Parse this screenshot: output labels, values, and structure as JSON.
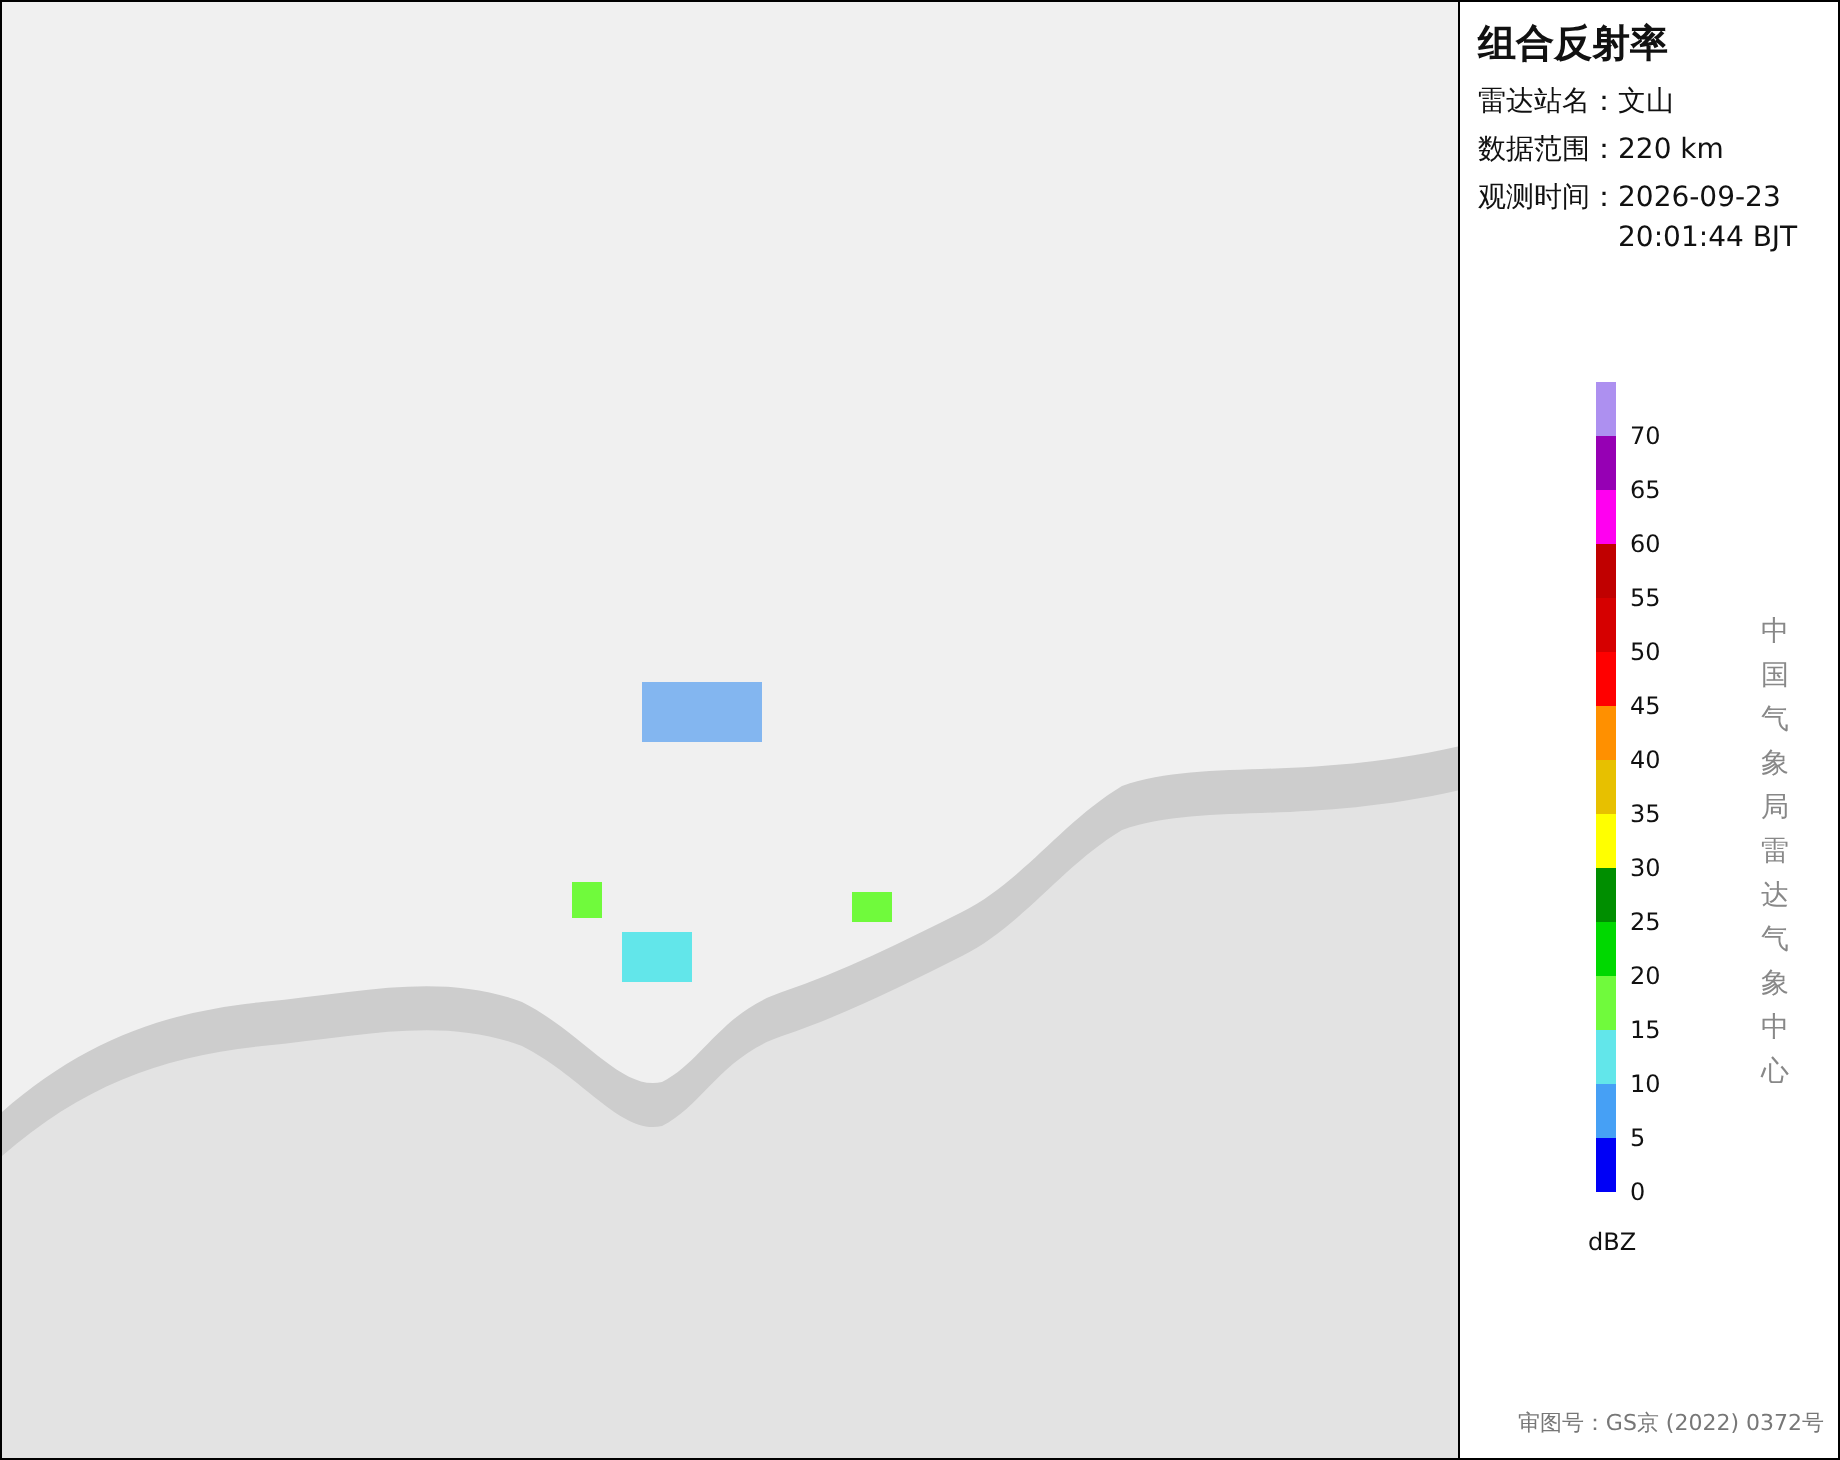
{
  "panel": {
    "title": "组合反射率",
    "info": [
      {
        "label": "雷达站名：",
        "value": "文山"
      },
      {
        "label": "数据范围：",
        "value": "220 km"
      },
      {
        "label": "观测时间：",
        "value": "2026-09-23 20:01:44 BJT"
      }
    ]
  },
  "legend": {
    "scale": [
      {
        "color": "#ad90f0"
      },
      {
        "color": "#9600b4",
        "label": "70"
      },
      {
        "color": "#ff00f0",
        "label": "65"
      },
      {
        "color": "#c00000",
        "label": "60"
      },
      {
        "color": "#d60000",
        "label": "55"
      },
      {
        "color": "#ff0000",
        "label": "50"
      },
      {
        "color": "#ff9000",
        "label": "45"
      },
      {
        "color": "#e7c000",
        "label": "40"
      },
      {
        "color": "#ffff00",
        "label": "35"
      },
      {
        "color": "#008e00",
        "label": "30"
      },
      {
        "color": "#00d800",
        "label": "25"
      },
      {
        "color": "#70fa3c",
        "label": "20"
      },
      {
        "color": "#62e6ea",
        "label": "15"
      },
      {
        "color": "#46a0f5",
        "label": "10"
      },
      {
        "color": "#0000f6",
        "label": "5"
      }
    ],
    "bottom_label": "0",
    "unit": "dBZ"
  },
  "source": "中国气象局雷达气象中心",
  "footer": "审图号：GS京 (2022) 0372号"
}
